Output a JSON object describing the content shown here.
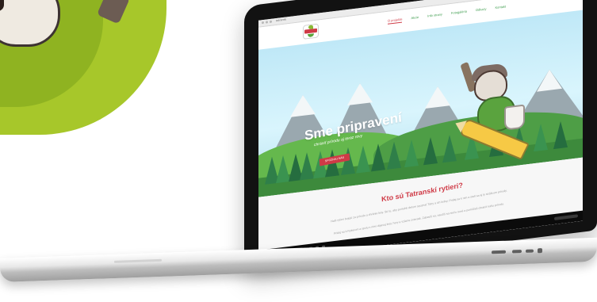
{
  "site": {
    "browser_tab": "tatransk",
    "nav": [
      {
        "label": "O projekte",
        "active": true
      },
      {
        "label": "Akcie",
        "active": false
      },
      {
        "label": "Info strany",
        "active": false
      },
      {
        "label": "Fotogaléria",
        "active": false
      },
      {
        "label": "Odkazy",
        "active": false
      },
      {
        "label": "Kontakt",
        "active": false
      }
    ],
    "hero": {
      "title": "Sme pripravení",
      "subtitle": "chrániť prírodu aj teraz rovy",
      "button_label": "SPOZNAJ NÁS"
    },
    "section": {
      "title": "Kto sú Tatranskí rytieri?",
      "paragraph_1": "Naši rytieri bojujú za prírodu a chránia lesy. Sú tu, aby pomohli deťom spoznať Tatry a ich krásy. Pridaj sa k nim a staň sa aj ty strážcom prírody.",
      "paragraph_2": "Pridaj sa k Rytierom a spolu s nimi objavuj lesy, hory a vzácne zvieratá. Zabavíš sa, naučíš sa niečo nové a pomôžeš chrániť našu prírodu."
    }
  },
  "colors": {
    "accent": "#cf3a46",
    "green": "#3d9c4d",
    "lime": "#a7c72a"
  }
}
